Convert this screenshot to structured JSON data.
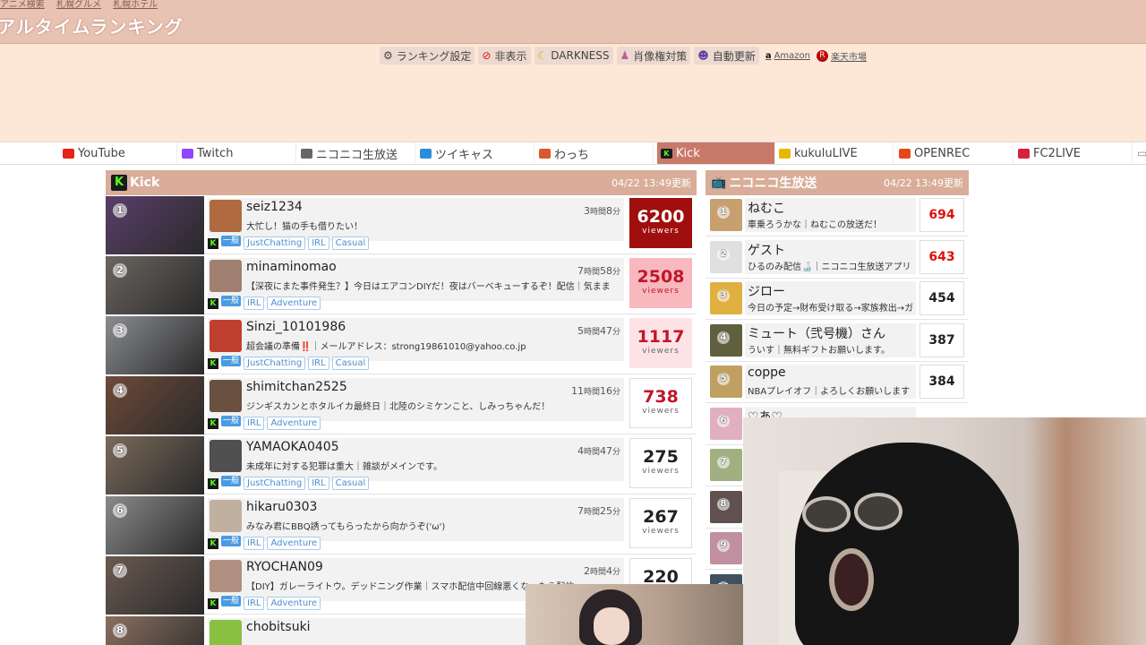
{
  "header": {
    "crumbs": [
      "アニメ検索",
      "札幌グルメ",
      "札幌ホテル"
    ],
    "title": "アルタイムランキング"
  },
  "toolbar": {
    "ranking_settings": "ランキング設定",
    "hide": "非表示",
    "darkness": "DARKNESS",
    "portrait_rights": "肖像権対策",
    "auto_update": "自動更新",
    "amazon": "Amazon",
    "rakuten": "楽天市場"
  },
  "tabs": [
    {
      "label": "YouTube",
      "icon": "youtube-icon",
      "color": "#e62117"
    },
    {
      "label": "Twitch",
      "icon": "twitch-icon",
      "color": "#9146ff"
    },
    {
      "label": "ニコニコ生放送",
      "icon": "niconico-icon",
      "color": "#666666"
    },
    {
      "label": "ツイキャス",
      "icon": "twitcasting-icon",
      "color": "#2a8fd8"
    },
    {
      "label": "わっち",
      "icon": "wacchi-icon",
      "color": "#d85a2a"
    },
    {
      "label": "Kick",
      "icon": "kick-icon",
      "color": "#53fc18",
      "active": true
    },
    {
      "label": "kukuluLIVE",
      "icon": "kukulu-icon",
      "color": "#e8b800"
    },
    {
      "label": "OPENREC",
      "icon": "openrec-icon",
      "color": "#e8471a"
    },
    {
      "label": "FC2LIVE",
      "icon": "fc2-icon",
      "color": "#d8203a"
    }
  ],
  "kick_panel": {
    "title": "Kick",
    "updated": "04/22 13:49更新",
    "viewers_label": "viewers",
    "badge": "一般",
    "rows": [
      {
        "rank": "1",
        "name": "seiz1234",
        "desc": "大忙し！猫の手も借りたい！",
        "dur_h": "3",
        "dur_m": "8",
        "viewers": "6200",
        "tags": [
          "JustChatting",
          "IRL",
          "Casual"
        ]
      },
      {
        "rank": "2",
        "name": "minaminomao",
        "desc": "【深夜にまた事件発生？】今日はエアコンDIYだ！夜はバーベキューするぞ！配信｜気まま",
        "dur_h": "7",
        "dur_m": "58",
        "viewers": "2508",
        "tags": [
          "IRL",
          "Adventure"
        ]
      },
      {
        "rank": "3",
        "name": "Sinzi_10101986",
        "desc": "超会議の準備‼️｜メールアドレス：strong19861010@yahoo.co.jp",
        "dur_h": "5",
        "dur_m": "47",
        "viewers": "1117",
        "tags": [
          "JustChatting",
          "IRL",
          "Casual"
        ]
      },
      {
        "rank": "4",
        "name": "shimitchan2525",
        "desc": "ジンギスカンとホタルイカ最終日｜北陸のシミケンこと、しみっちゃんだ！",
        "dur_h": "11",
        "dur_m": "16",
        "viewers": "738",
        "tags": [
          "IRL",
          "Adventure"
        ]
      },
      {
        "rank": "5",
        "name": "YAMAOKA0405",
        "desc": "未成年に対する犯罪は重大｜雑談がメインです。",
        "dur_h": "4",
        "dur_m": "47",
        "viewers": "275",
        "tags": [
          "JustChatting",
          "IRL",
          "Casual"
        ]
      },
      {
        "rank": "6",
        "name": "hikaru0303",
        "desc": "みなみ君にBBQ誘ってもらったから向かうぞ('ω')",
        "dur_h": "7",
        "dur_m": "25",
        "viewers": "267",
        "tags": [
          "IRL",
          "Adventure"
        ]
      },
      {
        "rank": "7",
        "name": "RYOCHAN09",
        "desc": "【DIY】ガレーライトウ。デッドニング作業｜スマホ配信中回線悪くなったら配信",
        "dur_h": "2",
        "dur_m": "4",
        "viewers": "220",
        "tags": [
          "IRL",
          "Adventure"
        ]
      },
      {
        "rank": "8",
        "name": "chobitsuki",
        "desc": "",
        "dur_h": "",
        "dur_m": "",
        "viewers": "",
        "tags": []
      }
    ]
  },
  "nico_panel": {
    "title": "ニコニコ生放送",
    "updated": "04/22 13:49更新",
    "rows": [
      {
        "rank": "1",
        "name": "ねむこ",
        "desc": "車乗ろうかな｜ねむこの放送だ！",
        "count": "694"
      },
      {
        "rank": "2",
        "name": "ゲスト",
        "desc": "ひるのみ配信🍶｜ニコニコ生放送アプリ",
        "count": "643"
      },
      {
        "rank": "3",
        "name": "ジロー",
        "desc": "今日の予定→財布受け取る→家族救出→ガ",
        "count": "454"
      },
      {
        "rank": "4",
        "name": "ミュート（弐号機）さん",
        "desc": "ういす｜無料ギフトお願いします。",
        "count": "387"
      },
      {
        "rank": "5",
        "name": "coppe",
        "desc": "NBAプレイオフ｜よろしくお願いします",
        "count": "384"
      },
      {
        "rank": "6",
        "name": "♡あ♡",
        "desc": "",
        "count": ""
      },
      {
        "rank": "7",
        "name": "",
        "desc": "",
        "count": ""
      },
      {
        "rank": "8",
        "name": "",
        "desc": "",
        "count": ""
      },
      {
        "rank": "9",
        "name": "",
        "desc": "",
        "count": ""
      },
      {
        "rank": "10",
        "name": "",
        "desc": "",
        "count": ""
      },
      {
        "rank": "11",
        "name": "",
        "desc": "",
        "count": ""
      }
    ]
  },
  "colors": {
    "header_bg": "#e8c3b3",
    "band_bg": "#fde8d8",
    "panel_head": "#d9ad99",
    "kick_green": "#53fc18",
    "rank1_bg": "#a00e0e"
  }
}
